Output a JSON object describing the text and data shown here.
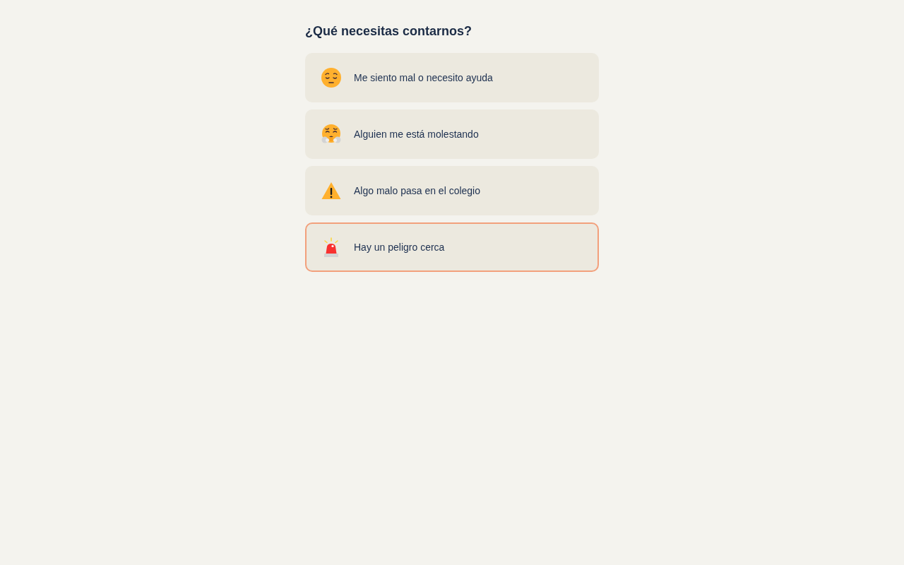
{
  "title": "¿Qué necesitas contarnos?",
  "options": [
    {
      "kind": "sad",
      "label": "Me siento mal o necesito ayuda",
      "selected": false
    },
    {
      "kind": "upset",
      "label": "Alguien me está molestando",
      "selected": false
    },
    {
      "kind": "warning",
      "label": "Algo malo pasa en el colegio",
      "selected": false
    },
    {
      "kind": "danger",
      "label": "Hay un peligro cerca",
      "selected": true
    }
  ]
}
